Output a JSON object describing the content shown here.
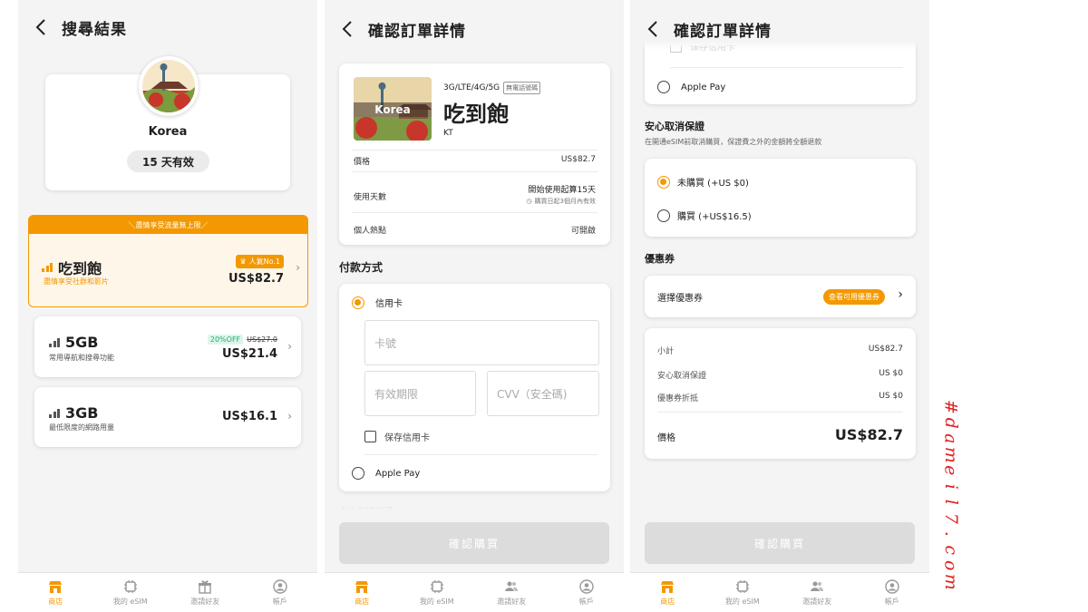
{
  "colors": {
    "accent": "#f39800",
    "accent_light": "#fff6ea",
    "discount_green": "#20b070",
    "watermark": "#e02020"
  },
  "screen1": {
    "title": "搜尋結果",
    "country": "Korea",
    "validity": "15 天有效",
    "banner": "＼盡情享受流量無上限／",
    "plans": [
      {
        "name": "吃到飽",
        "desc": "盡情享受社群和影片",
        "badge": "人氣No.1",
        "price": "US$82.7"
      },
      {
        "name": "5GB",
        "desc": "常用導航和搜尋功能",
        "discount": "20%OFF",
        "old_price": "US$27.0",
        "price": "US$21.4"
      },
      {
        "name": "3GB",
        "desc": "最低限度的網路用量",
        "price": "US$16.1"
      }
    ]
  },
  "screen2": {
    "title": "確認訂單詳情",
    "product": {
      "image_label": "Korea",
      "network": "3G/LTE/4G/5G",
      "no_phone": "無電話號碼",
      "name": "吃到飽",
      "carrier": "KT"
    },
    "details": [
      {
        "label": "價格",
        "value": "US$82.7"
      },
      {
        "label": "使用天數",
        "value": "開始使用起算15天",
        "note": "購買日起3個月內有效"
      },
      {
        "label": "個人熱點",
        "value": "可開啟"
      }
    ],
    "payment_heading": "付款方式",
    "credit_card": "信用卡",
    "card_number_placeholder": "卡號",
    "expiry_placeholder": "有效期限",
    "cvv_placeholder": "CVV（安全碼)",
    "save_card": "保存信用卡",
    "apple_pay": "Apple Pay",
    "faded_heading": "安心取消保證",
    "confirm": "確認購買"
  },
  "screen3": {
    "title": "確認訂單詳情",
    "faded_top": "保存信用卡",
    "apple_pay": "Apple Pay",
    "insurance_title": "安心取消保證",
    "insurance_desc": "在開通eSIM前取消購買，保證費之外的金額將全額退款",
    "insurance_options": [
      "未購買 (+US $0)",
      "購買 (+US$16.5)"
    ],
    "coupon_heading": "優惠券",
    "coupon_select": "選擇優惠券",
    "coupon_badge": "查看可用優惠券",
    "summary": [
      {
        "label": "小計",
        "value": "US$82.7"
      },
      {
        "label": "安心取消保證",
        "value": "US $0"
      },
      {
        "label": "優惠券折抵",
        "value": "US $0"
      }
    ],
    "total_label": "價格",
    "total_value": "US$82.7",
    "confirm": "確認購買"
  },
  "tabbar": [
    "商店",
    "我的 eSIM",
    "邀請好友",
    "帳戶"
  ],
  "watermark": "#dameil7.com"
}
